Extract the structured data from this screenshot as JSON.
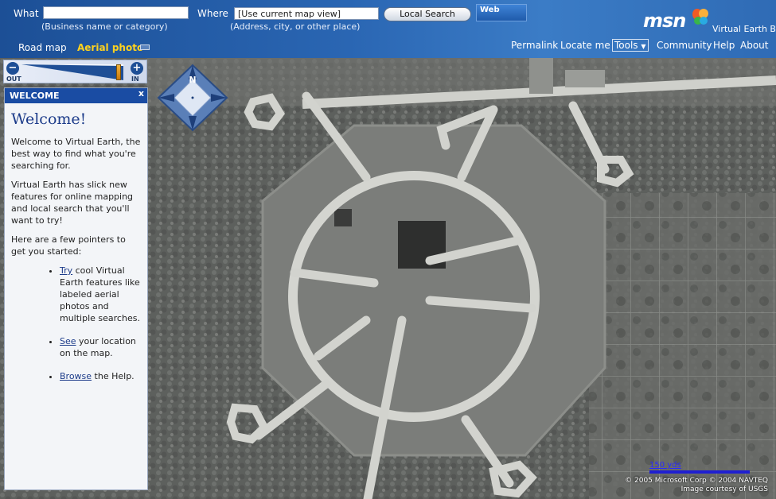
{
  "header": {
    "what_label": "What",
    "what_value": "",
    "what_hint": "(Business name or category)",
    "where_label": "Where",
    "where_value": "[Use current map view]",
    "where_hint": "(Address, city, or other place)",
    "search_button": "Local Search",
    "web_tab": "Web",
    "logo": "msn",
    "product": "Virtual Earth BETA",
    "view_road": "Road map",
    "view_aerial": "Aerial photo",
    "nav": [
      "Permalink",
      "Locate me",
      "Tools",
      "Community",
      "Help",
      "About"
    ]
  },
  "zoom": {
    "out_symbol": "−",
    "in_symbol": "+",
    "out_label": "OUT",
    "in_label": "IN",
    "level": 0.95
  },
  "compass": {
    "north_label": "N"
  },
  "panel": {
    "bar_title": "WELCOME",
    "close_label": "x",
    "title": "Welcome!",
    "para1": "Welcome to Virtual Earth, the best way to find what you're searching for.",
    "para2": "Virtual Earth has slick new features for online mapping and local search that you'll want to try!",
    "para3": "Here are a few pointers to get you started:",
    "tips": [
      {
        "link": "Try",
        "text": " cool Virtual Earth features like labeled aerial photos and multiple searches."
      },
      {
        "link": "See",
        "text": " your location on the map."
      },
      {
        "link": "Browse",
        "text": " the Help."
      }
    ]
  },
  "map": {
    "scale_label": "150 yds",
    "copyright_line1": "© 2005 Microsoft Corp   © 2004 NAVTEQ",
    "copyright_line2": "Image courtesy of USGS"
  },
  "colors": {
    "header_blue": "#2a66b3",
    "aerial_highlight": "#ffd21e",
    "panel_bar": "#1a4ca3",
    "link": "#1d3c8a"
  }
}
